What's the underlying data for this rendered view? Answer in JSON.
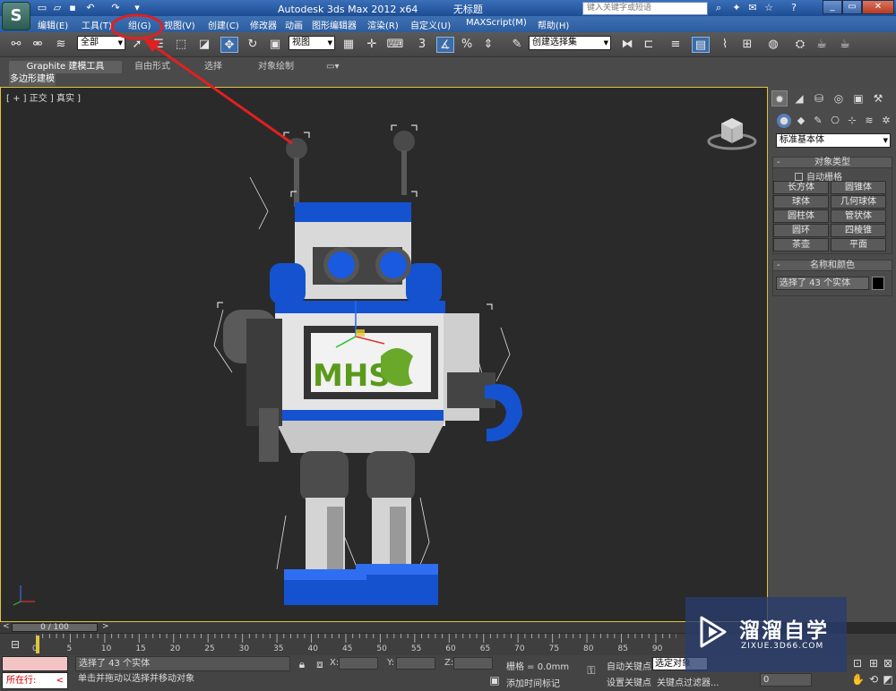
{
  "titlebar": {
    "app_name": "Autodesk 3ds Max  2012 x64",
    "file_name": "无标题",
    "search_placeholder": "键入关键字或短语"
  },
  "menu": [
    "编辑(E)",
    "工具(T)",
    "组(G)",
    "视图(V)",
    "创建(C)",
    "修改器",
    "动画",
    "图形编辑器",
    "渲染(R)",
    "自定义(U)",
    "MAXScript(M)",
    "帮助(H)"
  ],
  "toolbar": {
    "filter_value": "全部",
    "ref_coord_value": "视图",
    "named_selection_value": "创建选择集"
  },
  "ribbon": {
    "tabs": [
      "Graphite 建模工具",
      "自由形式",
      "选择",
      "对象绘制"
    ],
    "panel": "多边形建模"
  },
  "viewport": {
    "label": "[ + ] 正交 ] 真实 ]",
    "model_text": "MHS"
  },
  "command_panel": {
    "category": "标准基本体",
    "object_type_title": "对象类型",
    "autogrid_label": "自动栅格",
    "object_buttons": [
      "长方体",
      "圆锥体",
      "球体",
      "几何球体",
      "圆柱体",
      "管状体",
      "圆环",
      "四棱锥",
      "茶壶",
      "平面"
    ],
    "name_color_title": "名称和颜色",
    "selection_name": "选择了 43 个实体"
  },
  "timeline": {
    "slider_text": "0 / 100",
    "ticks": [
      "0",
      "5",
      "10",
      "15",
      "20",
      "25",
      "30",
      "35",
      "40",
      "45",
      "50",
      "55",
      "60",
      "65",
      "70",
      "75",
      "80",
      "85",
      "90"
    ]
  },
  "statusbar": {
    "running_label": "所在行:",
    "status_line1": "选择了 43 个实体",
    "status_line2": "单击并拖动以选择并移动对象",
    "x_label": "X:",
    "y_label": "Y:",
    "z_label": "Z:",
    "grid_label": "栅格 = 0.0mm",
    "add_time_tag": "添加时间标记",
    "auto_key": "自动关键点",
    "set_key": "设置关键点",
    "selected_dd": "选定对象",
    "key_filters": "关键点过滤器...",
    "frame_value": "0"
  },
  "watermark": {
    "title": "溜溜自学",
    "url": "ZIXUE.3D66.COM"
  },
  "colors": {
    "viewport_border": "#e0c43a",
    "menu_bg": "#2c5c9e",
    "annotation": "#e02020",
    "robot_blue": "#1552d0"
  }
}
